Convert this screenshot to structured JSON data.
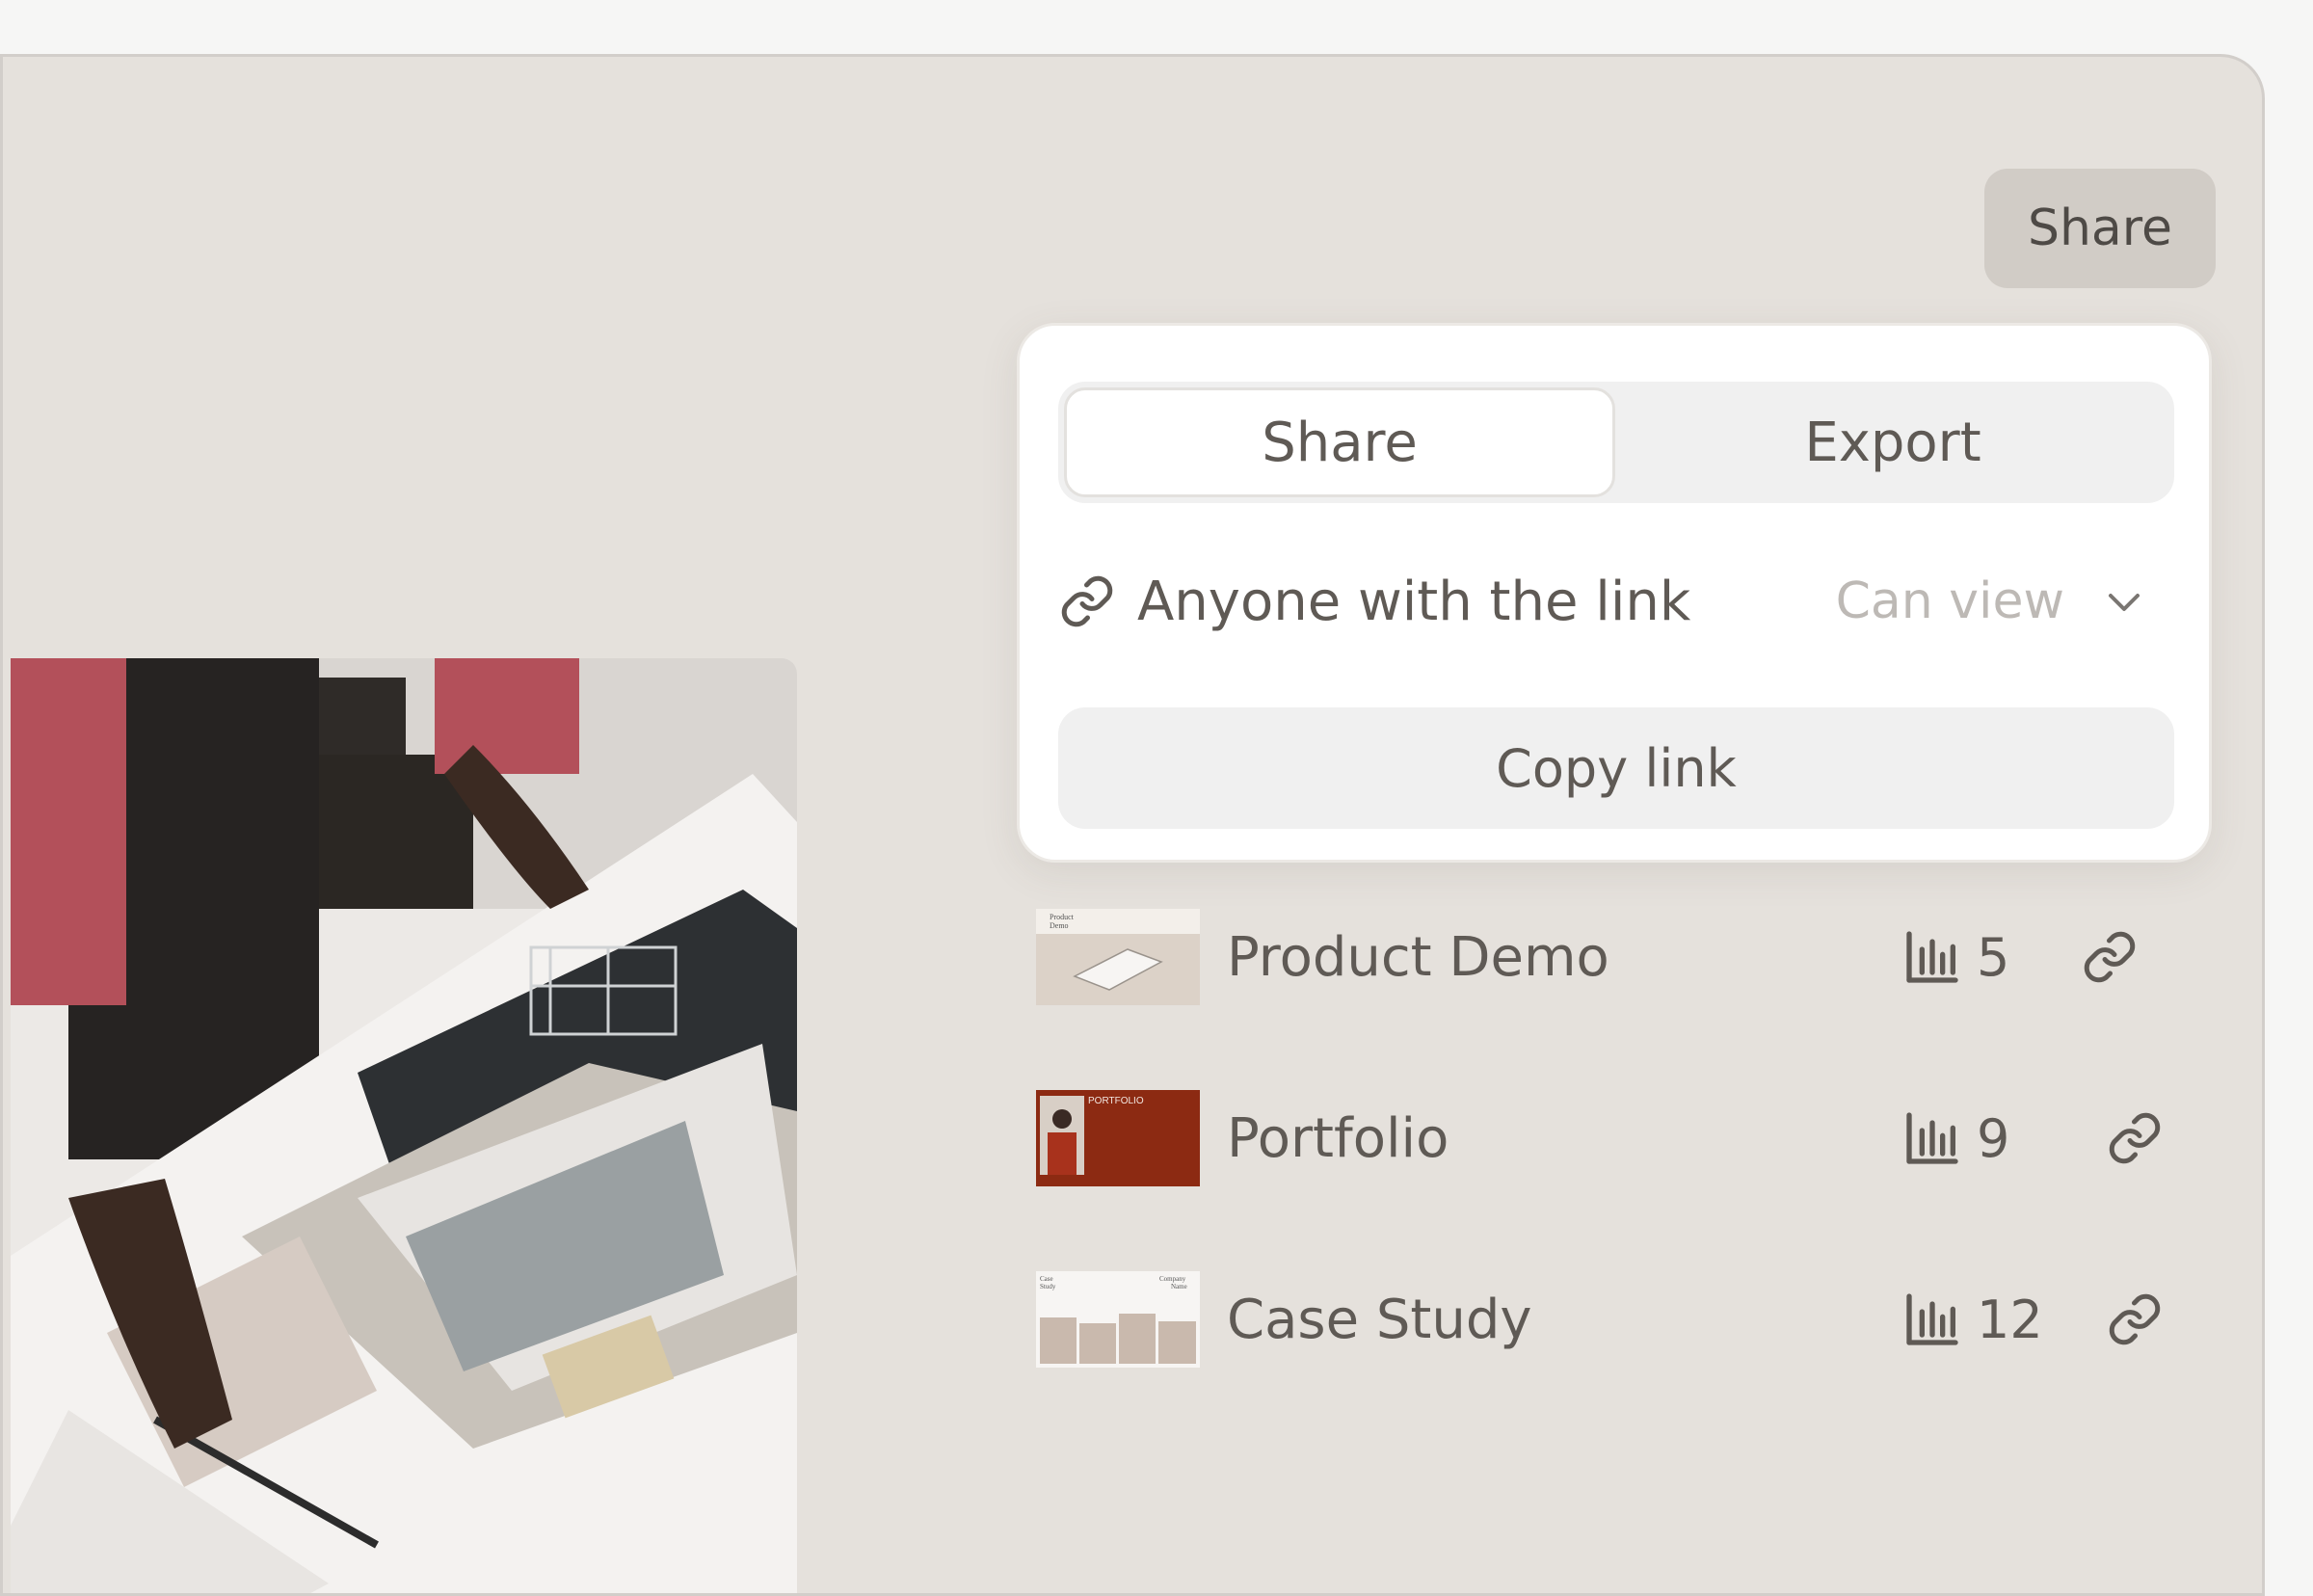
{
  "header": {
    "share_button": "Share"
  },
  "popover": {
    "tabs": [
      {
        "label": "Share",
        "active": true
      },
      {
        "label": "Export",
        "active": false
      }
    ],
    "link_access": {
      "label": "Anyone with the link",
      "permission": "Can view"
    },
    "copy_button": "Copy link"
  },
  "items": [
    {
      "title": "Product Demo",
      "views": "5",
      "thumb_text": [
        "Product",
        "Demo"
      ]
    },
    {
      "title": "Portfolio",
      "views": "9",
      "thumb_text": [
        "PORTFOLIO"
      ]
    },
    {
      "title": "Case Study",
      "views": "12",
      "thumb_text": [
        "Case",
        "Study",
        "Company",
        "Name"
      ]
    }
  ],
  "colors": {
    "window_bg": "#e5e1dc",
    "accent_red": "#8c2a12",
    "text": "#5f5a55"
  }
}
